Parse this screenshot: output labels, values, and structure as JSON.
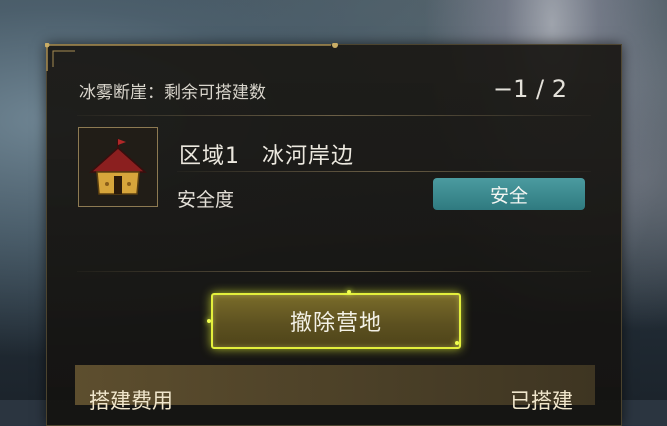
{
  "header": {
    "title": "冰雾断崖：剩余可搭建数",
    "count": "−1 / 2"
  },
  "camp": {
    "region_number": "区域1",
    "region_name": "冰河岸边",
    "safety_label": "安全度",
    "safety_value": "安全",
    "icon": "camp-tent-icon"
  },
  "actions": {
    "remove_label": "撤除营地"
  },
  "cost": {
    "label": "搭建费用",
    "status": "已搭建"
  },
  "colors": {
    "badge": "#3a8a90",
    "button_glow": "#e3ef3c",
    "cost_row": "#5d4e2e"
  }
}
